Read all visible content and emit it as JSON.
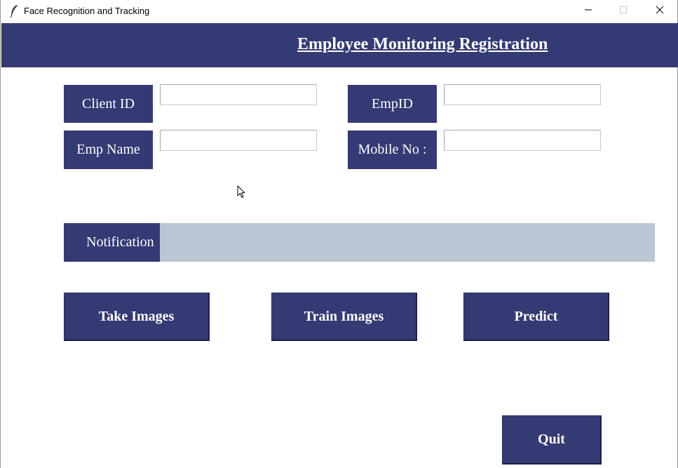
{
  "window": {
    "title": "Face Recognition and Tracking",
    "app_icon": "feather-icon",
    "controls": {
      "minimize_icon": "minimize-icon",
      "maximize_icon": "maximize-icon",
      "close_icon": "close-icon"
    }
  },
  "header": {
    "title": "Employee Monitoring Registration"
  },
  "form": {
    "client_id": {
      "label": "Client ID",
      "value": "",
      "placeholder": ""
    },
    "emp_id": {
      "label": "EmpID",
      "value": "",
      "placeholder": ""
    },
    "emp_name": {
      "label": "Emp Name",
      "value": "",
      "placeholder": ""
    },
    "mobile_no": {
      "label": "Mobile No :",
      "value": "",
      "placeholder": ""
    }
  },
  "notification": {
    "label": "Notification",
    "message": ""
  },
  "actions": {
    "take_images": "Take Images",
    "train_images": "Train Images",
    "predict": "Predict",
    "quit": "Quit"
  },
  "colors": {
    "primary": "#333a74",
    "notification_bg": "#bbc6d4",
    "text_on_primary": "#ffffff",
    "background": "#ffffff"
  }
}
